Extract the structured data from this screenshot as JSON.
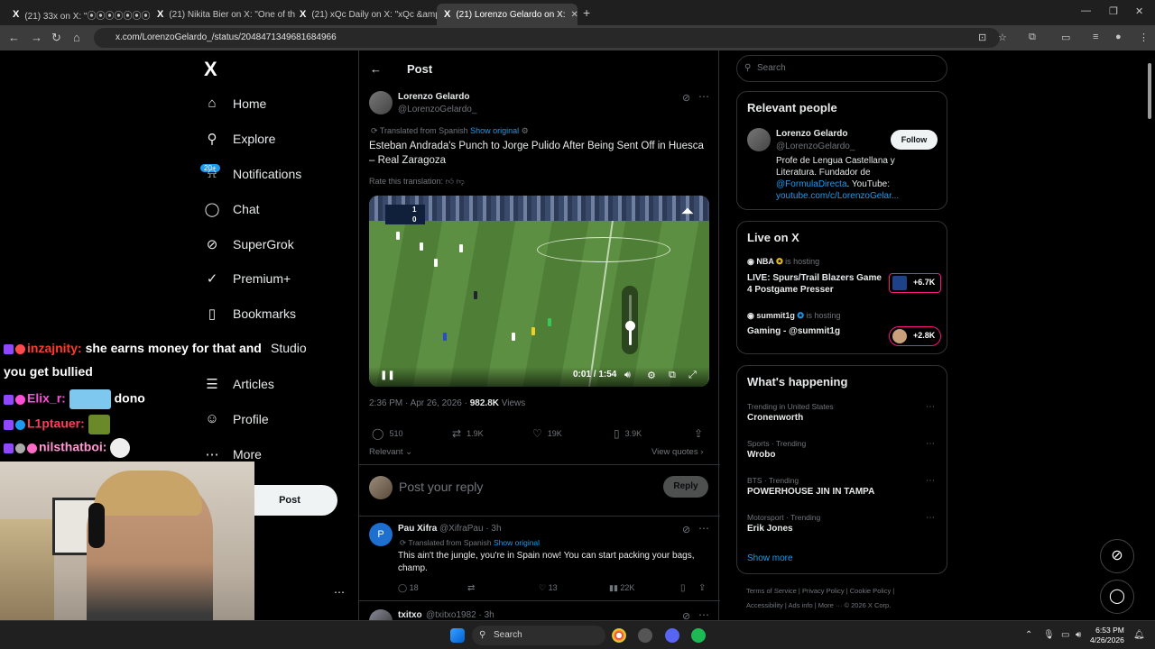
{
  "browser": {
    "tabs": [
      {
        "title": "(21) 33x on X: \"⦿⦿⦿⦿⦿⦿⦿",
        "active": false
      },
      {
        "title": "(21) Nikita Bier on X: \"One of th",
        "active": false
      },
      {
        "title": "(21) xQc Daily on X: \"xQc &amp",
        "active": false
      },
      {
        "title": "(21) Lorenzo Gelardo on X:",
        "active": true
      }
    ],
    "url": "x.com/LorenzoGelardo_/status/2048471349681684966"
  },
  "nav": {
    "logo": "X",
    "items": [
      {
        "label": "Home",
        "icon": "home-icon",
        "glyph": "⌂"
      },
      {
        "label": "Explore",
        "icon": "search-icon",
        "glyph": "⚲"
      },
      {
        "label": "Notifications",
        "icon": "bell-icon",
        "glyph": "⍾"
      },
      {
        "label": "Chat",
        "icon": "chat-icon",
        "glyph": "◯"
      },
      {
        "label": "SuperGrok",
        "icon": "grok-icon",
        "glyph": "⊘"
      },
      {
        "label": "Premium+",
        "icon": "premium-icon",
        "glyph": "✓"
      },
      {
        "label": "Bookmarks",
        "icon": "bookmark-icon",
        "glyph": "▯"
      },
      {
        "label": "Studio",
        "icon": "studio-icon",
        "glyph": "▣"
      },
      {
        "label": "Articles",
        "icon": "articles-icon",
        "glyph": "☰"
      },
      {
        "label": "Profile",
        "icon": "profile-icon",
        "glyph": "☺"
      },
      {
        "label": "More",
        "icon": "more-icon",
        "glyph": "⋯"
      }
    ],
    "notif_badge": "20+",
    "post_button": "Post"
  },
  "chat": [
    {
      "user": "inzajnity:",
      "user_color": "#ff3b30",
      "text": "she earns money for that and"
    },
    {
      "user": "",
      "user_color": "#ffffff",
      "text": "you get bullied"
    },
    {
      "user": "Elix_r:",
      "user_color": "#ff4fd8",
      "text": "dono"
    },
    {
      "user": "L1ptauer:",
      "user_color": "#ff3b5c",
      "text": ""
    },
    {
      "user": "nilsthatboi:",
      "user_color": "#ff9ad5",
      "text": ""
    }
  ],
  "main": {
    "header": "Post",
    "author_name": "Lorenzo Gelardo",
    "author_handle": "@LorenzoGelardo_",
    "translated_from": "Translated from Spanish",
    "show_original": "Show original",
    "tweet_text": "Esteban Andrada's Punch to Jorge Pulido After Being Sent Off in Huesca – Real Zaragoza",
    "rate_translation": "Rate this translation:",
    "video": {
      "time": "0:01 / 1:54",
      "score_home": "1",
      "score_away": "0",
      "volume": 0.4
    },
    "timestamp": "2:36 PM · Apr 26, 2026 ·",
    "views_count": "982.8K",
    "views_label": "Views",
    "actions": {
      "replies": "510",
      "reposts": "1.9K",
      "likes": "19K",
      "bookmarks": "3.9K"
    },
    "relevant": "Relevant",
    "view_quotes": "View quotes",
    "reply_placeholder": "Post your reply",
    "reply_button": "Reply",
    "replies": [
      {
        "name": "Pau Xifra",
        "handle": "@XifraPau · 3h",
        "translated": "Translated from Spanish",
        "show_original": "Show original",
        "text": "This ain't the jungle, you're in Spain now! You can start packing your bags, champ.",
        "stats": {
          "replies": "18",
          "likes": "13",
          "views": "22K"
        }
      },
      {
        "name": "txitxo",
        "handle": "@txitxo1982 · 3h"
      }
    ]
  },
  "sidebar": {
    "search_placeholder": "Search",
    "relevant_people": {
      "title": "Relevant people",
      "name": "Lorenzo Gelardo",
      "handle": "@LorenzoGelardo_",
      "follow": "Follow",
      "bio_1": "Profe de Lengua Castellana y Literatura. Fundador de",
      "bio_link": "@FormulaDirecta",
      "bio_2": ". YouTube:",
      "bio_url": "youtube.com/c/LorenzoGelar..."
    },
    "live": {
      "title": "Live on X",
      "items": [
        {
          "host": "NBA",
          "status": "is hosting",
          "title": "LIVE: Spurs/Trail Blazers Game 4 Postgame Presser",
          "count": "+6.7K"
        },
        {
          "host": "summit1g",
          "status": "is hosting",
          "title": "Gaming - @summit1g",
          "count": "+2.8K"
        }
      ]
    },
    "happening": {
      "title": "What's happening",
      "trends": [
        {
          "category": "Trending in United States",
          "name": "Cronenworth"
        },
        {
          "category": "Sports · Trending",
          "name": "Wrobo"
        },
        {
          "category": "BTS · Trending",
          "name": "POWERHOUSE JIN IN TAMPA"
        },
        {
          "category": "Motorsport · Trending",
          "name": "Erik Jones"
        }
      ],
      "show_more": "Show more"
    },
    "footer": {
      "line1": "Terms of Service  |  Privacy Policy  |  Cookie Policy  |",
      "line2": "Accessibility  |  Ads info  |  More ···  © 2026 X Corp."
    }
  },
  "taskbar": {
    "search": "Search",
    "time": "6:53 PM",
    "date": "4/26/2026"
  },
  "colors": {
    "accent": "#1d9bf0",
    "live": "#f91880",
    "background": "#000000"
  }
}
